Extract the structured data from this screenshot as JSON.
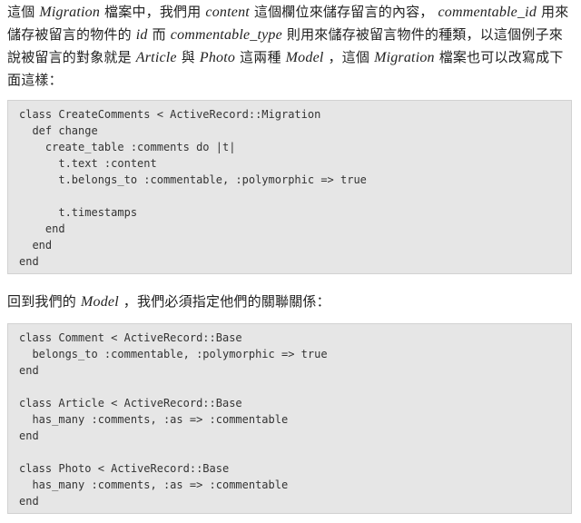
{
  "paragraph1": {
    "s1": "這個 ",
    "e1": "Migration",
    "s2": " 檔案中，我們用 ",
    "e2": "content",
    "s3": " 這個欄位來儲存留言的內容， ",
    "e3": "commentable_id",
    "s4": " 用來儲存被留言的物件的 ",
    "e4": "id",
    "s5": " 而 ",
    "e5": "commentable_type",
    "s6": " 則用來儲存被留言物件的種類，以這個例子來說被留言的對象就是 ",
    "e6": "Article",
    "s7": " 與 ",
    "e7": "Photo",
    "s8": " 這兩種 ",
    "e8": "Model",
    "s9": " ，這個 ",
    "e9": "Migration",
    "s10": " 檔案也可以改寫成下面這樣："
  },
  "code1": [
    "class CreateComments < ActiveRecord::Migration",
    "  def change",
    "    create_table :comments do |t|",
    "      t.text :content",
    "      t.belongs_to :commentable, :polymorphic => true",
    "",
    "      t.timestamps",
    "    end",
    "  end",
    "end"
  ],
  "paragraph2": {
    "s1": "回到我們的 ",
    "e1": "Model",
    "s2": " ，我們必須指定他們的關聯關係："
  },
  "code2": [
    "class Comment < ActiveRecord::Base",
    "  belongs_to :commentable, :polymorphic => true",
    "end",
    "",
    "class Article < ActiveRecord::Base",
    "  has_many :comments, :as => :commentable",
    "end",
    "",
    "class Photo < ActiveRecord::Base",
    "  has_many :comments, :as => :commentable",
    "end"
  ]
}
